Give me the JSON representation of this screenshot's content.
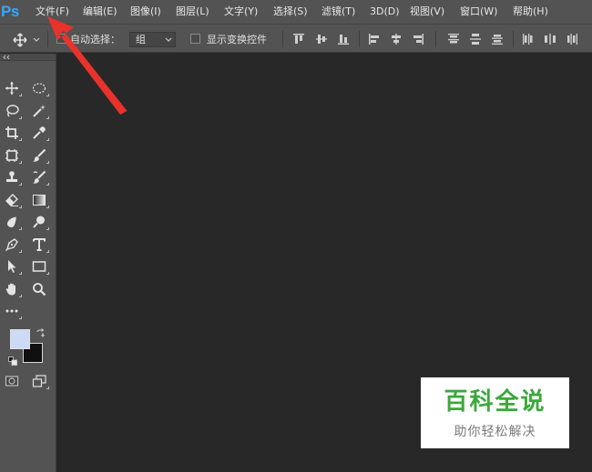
{
  "app": {
    "logo": "Ps"
  },
  "menubar": {
    "items": [
      "文件(F)",
      "编辑(E)",
      "图像(I)",
      "图层(L)",
      "文字(Y)",
      "选择(S)",
      "滤镜(T)",
      "3D(D)",
      "视图(V)",
      "窗口(W)",
      "帮助(H)"
    ]
  },
  "options": {
    "auto_select_label": "自动选择：",
    "auto_select_value": "组",
    "show_transform_label": "显示变换控件",
    "auto_select_checked": false,
    "show_transform_checked": false
  },
  "toolbox": {
    "tools": [
      [
        "move-tool",
        "marquee-ellipse-tool"
      ],
      [
        "lasso-tool",
        "magic-wand-tool"
      ],
      [
        "crop-tool",
        "eyedropper-tool"
      ],
      [
        "frame-tool",
        "brush-tool"
      ],
      [
        "stamp-tool",
        "history-brush-tool"
      ],
      [
        "eraser-tool",
        "gradient-tool"
      ],
      [
        "blur-tool",
        "dodge-tool"
      ],
      [
        "pen-tool",
        "type-tool"
      ],
      [
        "path-selection-tool",
        "rectangle-tool"
      ],
      [
        "hand-tool",
        "zoom-tool"
      ],
      [
        "more-tools"
      ]
    ],
    "foreground_color": "#cbdaf5",
    "background_color": "#101010"
  },
  "colors": {
    "ps_blue": "#31a8ff",
    "annotation_red": "#e8322b",
    "watermark_green": "#3ba83c"
  },
  "watermark": {
    "title": "百科全说",
    "subtitle": "助你轻松解决"
  }
}
